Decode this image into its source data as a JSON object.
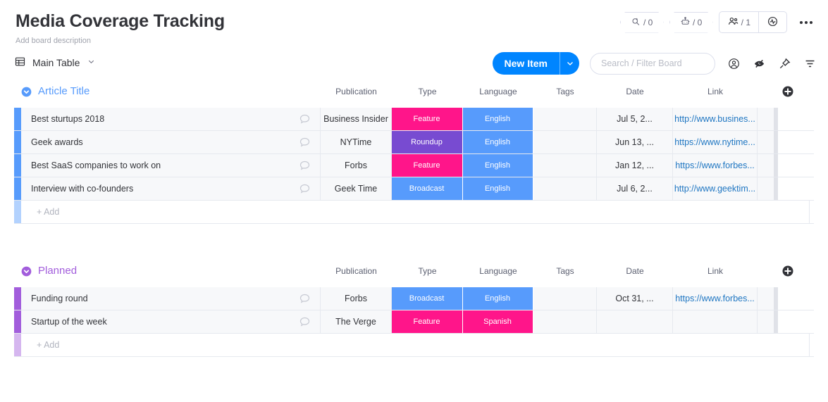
{
  "header": {
    "title": "Media Coverage Tracking",
    "description": "Add board description",
    "badges": [
      {
        "icon": "search-pen-icon",
        "value": "/ 0"
      },
      {
        "icon": "robot-icon",
        "value": "/ 0"
      }
    ],
    "members": {
      "icon": "people-icon",
      "value": "/ 1"
    },
    "activity": {
      "icon": "activity-pulse-icon"
    },
    "more": {
      "icon": "kebab-menu-icon"
    }
  },
  "toolbar": {
    "tab_icon": "table-icon",
    "tab_label": "Main Table",
    "tab_caret": "chevron-down-icon",
    "new_item_label": "New Item",
    "new_item_caret": "chevron-down-icon",
    "search_placeholder": "Search / Filter Board",
    "search_value": "",
    "icons": [
      "person-circle-icon",
      "eye-slash-icon",
      "pin-icon",
      "filter-icon"
    ]
  },
  "columns": [
    "Publication",
    "Type",
    "Language",
    "Tags",
    "Date",
    "Link"
  ],
  "add_column_label": "+",
  "add_row_label": "+ Add",
  "colors": {
    "accent_blue": "#0085ff",
    "group_blue": "#579bfc",
    "group_purple": "#a25ddc",
    "chip_pink": "#ff158a",
    "chip_purple": "#784bd1",
    "chip_blue": "#579bfc",
    "link_blue": "#1f76c2"
  },
  "groups": [
    {
      "name": "Article Title",
      "color": "#579bfc",
      "toggle_icon": "collapse-chevron-icon",
      "rows": [
        {
          "title": "Best sturtups 2018",
          "bubble_icon": "comment-bubble-icon",
          "publication": "Business Insider",
          "type": {
            "label": "Feature",
            "color": "#ff158a"
          },
          "language": {
            "label": "English",
            "color": "#579bfc"
          },
          "tags": "",
          "date": "Jul 5, 2...",
          "link": "http://www.busines..."
        },
        {
          "title": "Geek awards",
          "bubble_icon": "comment-bubble-icon",
          "publication": "NYTime",
          "type": {
            "label": "Roundup",
            "color": "#784bd1"
          },
          "language": {
            "label": "English",
            "color": "#579bfc"
          },
          "tags": "",
          "date": "Jun 13, ...",
          "link": "https://www.nytime..."
        },
        {
          "title": "Best SaaS companies to work on",
          "bubble_icon": "comment-bubble-icon",
          "publication": "Forbs",
          "type": {
            "label": "Feature",
            "color": "#ff158a"
          },
          "language": {
            "label": "English",
            "color": "#579bfc"
          },
          "tags": "",
          "date": "Jan 12, ...",
          "link": "https://www.forbes..."
        },
        {
          "title": "Interview with co-founders",
          "bubble_icon": "comment-bubble-icon",
          "publication": "Geek Time",
          "type": {
            "label": "Broadcast",
            "color": "#579bfc"
          },
          "language": {
            "label": "English",
            "color": "#579bfc"
          },
          "tags": "",
          "date": "Jul 6, 2...",
          "link": "http://www.geektim..."
        }
      ]
    },
    {
      "name": "Planned",
      "color": "#a25ddc",
      "toggle_icon": "collapse-chevron-icon",
      "rows": [
        {
          "title": "Funding round",
          "bubble_icon": "comment-bubble-icon",
          "publication": "Forbs",
          "type": {
            "label": "Broadcast",
            "color": "#579bfc"
          },
          "language": {
            "label": "English",
            "color": "#579bfc"
          },
          "tags": "",
          "date": "Oct 31, ...",
          "link": "https://www.forbes..."
        },
        {
          "title": "Startup of the week",
          "bubble_icon": "comment-bubble-icon",
          "publication": "The Verge",
          "type": {
            "label": "Feature",
            "color": "#ff158a"
          },
          "language": {
            "label": "Spanish",
            "color": "#ff158a"
          },
          "tags": "",
          "date": "",
          "link": ""
        }
      ]
    }
  ]
}
